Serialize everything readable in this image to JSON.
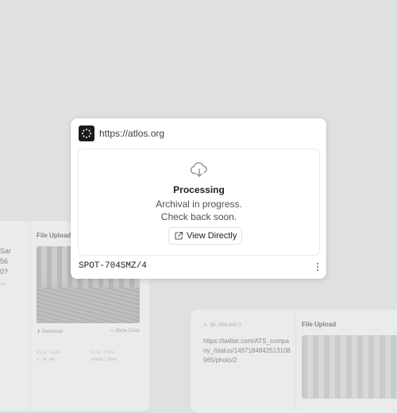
{
  "main_card": {
    "source_url": "https://atlos.org",
    "status_title": "Processing",
    "status_line1": "Archival in progress.",
    "status_line2": "Check back soon.",
    "view_button_label": "View Directly",
    "media_id": "SPOT-704SMZ/4",
    "icons": {
      "favicon": "atlos-logo-icon",
      "status": "cloud-download-icon",
      "button": "external-link-icon",
      "menu": "more-vertical-icon"
    }
  },
  "bg_left_card": {
    "text_fragments": [
      "Sar",
      "56",
      "0?",
      "..."
    ],
    "file_upload_title": "File Upload",
    "download_label": "Download",
    "show_color_label": "Show Color",
    "file_size_label": "FILE SIZE",
    "file_size_value": "0.14 MB",
    "file_type_label": "FILE TYPE",
    "file_type_value": "IMAGE/JPEG"
  },
  "bg_right_card": {
    "tag": "BK-PRNJW9/1",
    "link": "https://twitter.com/ATS_company_/status/1497184842513108965/photo/2",
    "file_upload_title": "File Upload"
  }
}
